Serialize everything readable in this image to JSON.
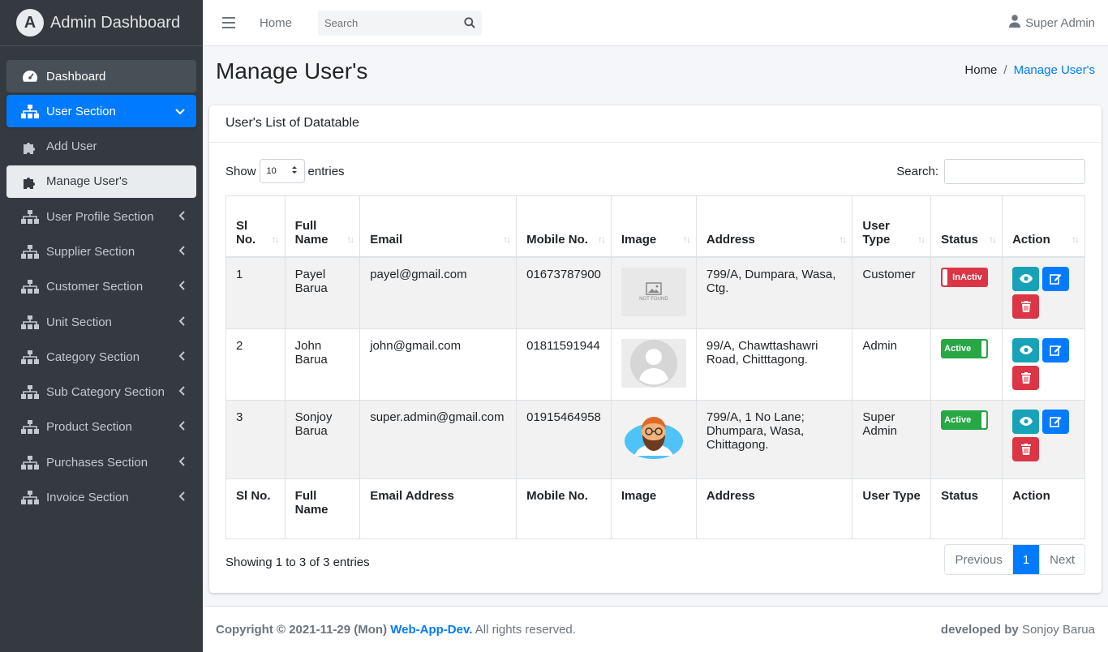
{
  "brand": {
    "title": "Admin Dashboard",
    "logo_letter": "A"
  },
  "sidebar": {
    "items": [
      {
        "label": "Dashboard",
        "icon": "tachometer-icon"
      },
      {
        "label": "User Section",
        "icon": "sitemap-icon"
      },
      {
        "label": "Add User",
        "icon": "puzzle-icon"
      },
      {
        "label": "Manage User's",
        "icon": "puzzle-icon"
      },
      {
        "label": "User Profile Section",
        "icon": "sitemap-icon"
      },
      {
        "label": "Supplier Section",
        "icon": "sitemap-icon"
      },
      {
        "label": "Customer Section",
        "icon": "sitemap-icon"
      },
      {
        "label": "Unit Section",
        "icon": "sitemap-icon"
      },
      {
        "label": "Category Section",
        "icon": "sitemap-icon"
      },
      {
        "label": "Sub Category Section",
        "icon": "sitemap-icon"
      },
      {
        "label": "Product Section",
        "icon": "sitemap-icon"
      },
      {
        "label": "Purchases Section",
        "icon": "sitemap-icon"
      },
      {
        "label": "Invoice Section",
        "icon": "sitemap-icon"
      }
    ]
  },
  "topbar": {
    "home": "Home",
    "search_placeholder": "Search",
    "user": "Super Admin"
  },
  "page": {
    "title": "Manage User's"
  },
  "breadcrumb": {
    "home": "Home",
    "sep": "/",
    "current": "Manage User's"
  },
  "card": {
    "header": "User's List of Datatable",
    "show_label": "Show",
    "show_value": "10",
    "entries_label": "entries",
    "search_label": "Search:"
  },
  "table": {
    "headers": [
      "Sl No.",
      "Full Name",
      "Email",
      "Mobile No.",
      "Image",
      "Address",
      "User Type",
      "Status",
      "Action"
    ],
    "footers": [
      "Sl No.",
      "Full Name",
      "Email Address",
      "Mobile No.",
      "Image",
      "Address",
      "User Type",
      "Status",
      "Action"
    ],
    "rows": [
      {
        "sl": "1",
        "name": "Payel Barua",
        "email": "payel@gmail.com",
        "mobile": "01673787900",
        "image": "not-found",
        "image_text": "NOT FOUND",
        "address": "799/A, Dumpara, Wasa, Ctg.",
        "type": "Customer",
        "status": "InActiv"
      },
      {
        "sl": "2",
        "name": "John Barua",
        "email": "john@gmail.com",
        "mobile": "01811591944",
        "image": "default-avatar",
        "address": "99/A, Chawttashawri Road, Chitttagong.",
        "type": "Admin",
        "status": "Active"
      },
      {
        "sl": "3",
        "name": "Sonjoy Barua",
        "email": "super.admin@gmail.com",
        "mobile": "01915464958",
        "image": "bearded-avatar",
        "address": "799/A, 1 No Lane; Dhumpara, Wasa, Chittagong.",
        "type": "Super Admin",
        "status": "Active"
      }
    ]
  },
  "pagination": {
    "info": "Showing 1 to 3 of 3 entries",
    "previous": "Previous",
    "page": "1",
    "next": "Next"
  },
  "footer": {
    "copyright": "Copyright © 2021-11-29 (Mon)",
    "link": "Web-App-Dev.",
    "rights": "All rights reserved.",
    "developed_by": "developed by",
    "developer": "Sonjoy Barua"
  },
  "colors": {
    "sidebar_bg": "#343a40",
    "primary": "#007bff",
    "danger": "#dc3545",
    "success": "#28a745",
    "info": "#17a2b8"
  }
}
